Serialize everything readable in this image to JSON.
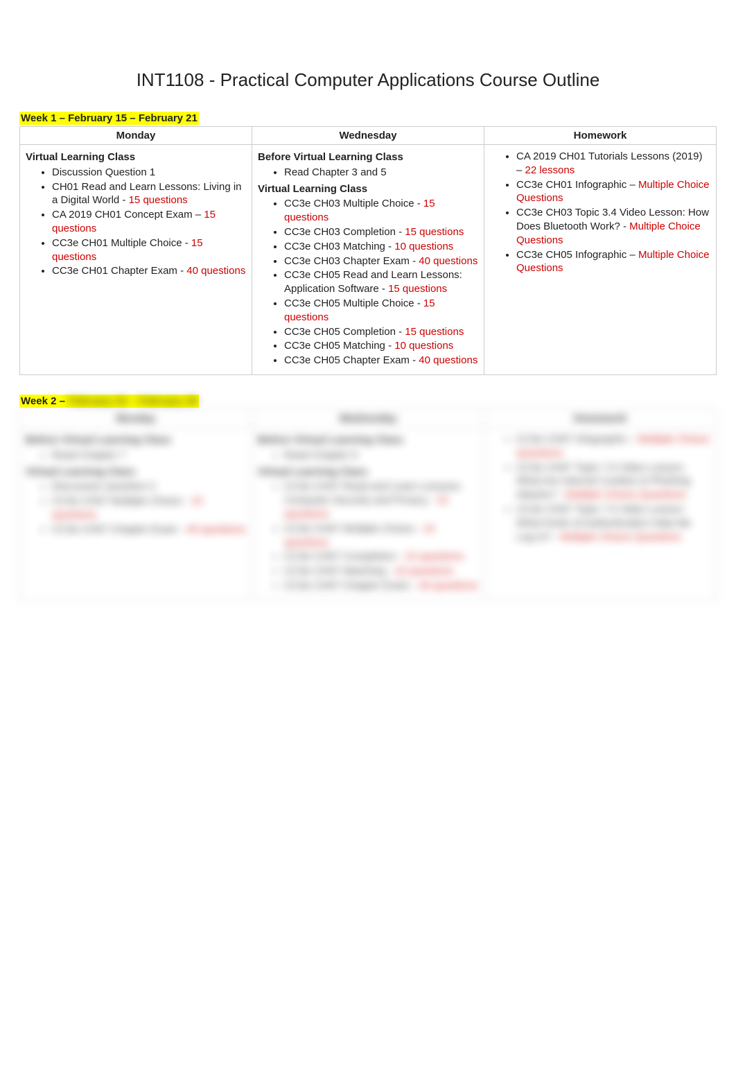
{
  "page_title": "INT1108 - Practical Computer Applications Course Outline",
  "week1": {
    "label": "Week 1 – February 15 – February 21",
    "headers": {
      "c1": "Monday",
      "c2": "Wednesday",
      "c3": "Homework"
    },
    "monday": {
      "h1": "Virtual Learning Class",
      "i1": "Discussion Question 1",
      "i2": {
        "t": "CH01 Read and Learn Lessons: Living in a Digital World - ",
        "r": "15 questions"
      },
      "i3": {
        "t": "CA 2019 CH01 Concept Exam – ",
        "r": "15 questions"
      },
      "i4": {
        "t": "CC3e CH01 Multiple Choice - ",
        "r": "15 questions"
      },
      "i5": {
        "t": "CC3e CH01 Chapter Exam - ",
        "r": "40 questions"
      }
    },
    "wednesday": {
      "h1": "Before Virtual Learning Class",
      "p1": "Read Chapter 3 and 5",
      "h2": "Virtual Learning Class",
      "i1": {
        "t": "CC3e CH03 Multiple Choice - ",
        "r": "15 questions"
      },
      "i2": {
        "t": "CC3e CH03 Completion - ",
        "r": "15 questions"
      },
      "i3": {
        "t": "CC3e CH03 Matching - ",
        "r": "10 questions"
      },
      "i4": {
        "t": "CC3e CH03 Chapter Exam - ",
        "r": "40 questions"
      },
      "i5": {
        "t": "CC3e CH05 Read and Learn Lessons: Application Software - ",
        "r": "15 questions"
      },
      "i6": {
        "t": "CC3e CH05 Multiple Choice - ",
        "r": "15 questions"
      },
      "i7": {
        "t": "CC3e CH05 Completion - ",
        "r": "15 questions"
      },
      "i8": {
        "t": "CC3e CH05 Matching - ",
        "r": "10 questions"
      },
      "i9": {
        "t": "CC3e CH05 Chapter Exam - ",
        "r": "40 questions"
      }
    },
    "homework": {
      "i1": {
        "t": "CA 2019 CH01 Tutorials Lessons (2019) – ",
        "r": "22 lessons"
      },
      "i2": {
        "t": "CC3e CH01 Infographic – ",
        "r": "Multiple Choice Questions"
      },
      "i3": {
        "t": "CC3e CH03 Topic 3.4 Video Lesson: How Does Bluetooth Work? - ",
        "r": "Multiple Choice Questions"
      },
      "i4": {
        "t": "CC3e CH05 Infographic – ",
        "r": "Multiple Choice Questions"
      }
    }
  },
  "week2": {
    "label_vis": "Week 2 – ",
    "label_hidden": "February 22 – February 28",
    "headers": {
      "c1": "Monday",
      "c2": "Wednesday",
      "c3": "Homework"
    },
    "monday": {
      "h1a": "Before Virtual Learning Class",
      "p1": "Read Chapter 7",
      "h1": "Virtual Learning Class",
      "i1": "Discussion Question 2",
      "i2": {
        "t": "CC3e CH07 Multiple Choice - ",
        "r": "15 questions"
      },
      "i3": {
        "t": "CC3e CH07 Chapter Exam - ",
        "r": "40 questions"
      }
    },
    "wednesday": {
      "h1a": "Before Virtual Learning Class",
      "p1": "Read Chapter 9",
      "h1": "Virtual Learning Class",
      "i1": {
        "t": "CC3e CH07 Read and Learn Lessons: Computer Security and Privacy - ",
        "r": "15 questions"
      },
      "i2": {
        "t": "CC3e CH07 Multiple Choice - ",
        "r": "15 questions"
      },
      "i3": {
        "t": "CC3e CH07 Completion - ",
        "r": "15 questions"
      },
      "i4": {
        "t": "CC3e CH07 Matching - ",
        "r": "10 questions"
      },
      "i5": {
        "t": "CC3e CH07 Chapter Exam - ",
        "r": "40 questions"
      }
    },
    "homework": {
      "i1": {
        "t": "CC3e CH07 Infographic – ",
        "r": "Multiple Choice Questions"
      },
      "i2": {
        "t": "CC3e CH07 Topic 7.6 Video Lesson: What Are Internet Cookies & Phishing Attacks? - ",
        "r": "Multiple Choice Questions"
      },
      "i3": {
        "t": "CC3e CH07 Topic 7.5 Video Lesson: What Kinds of Authentication Help Me Log In? - ",
        "r": "Multiple Choice Questions"
      }
    }
  }
}
